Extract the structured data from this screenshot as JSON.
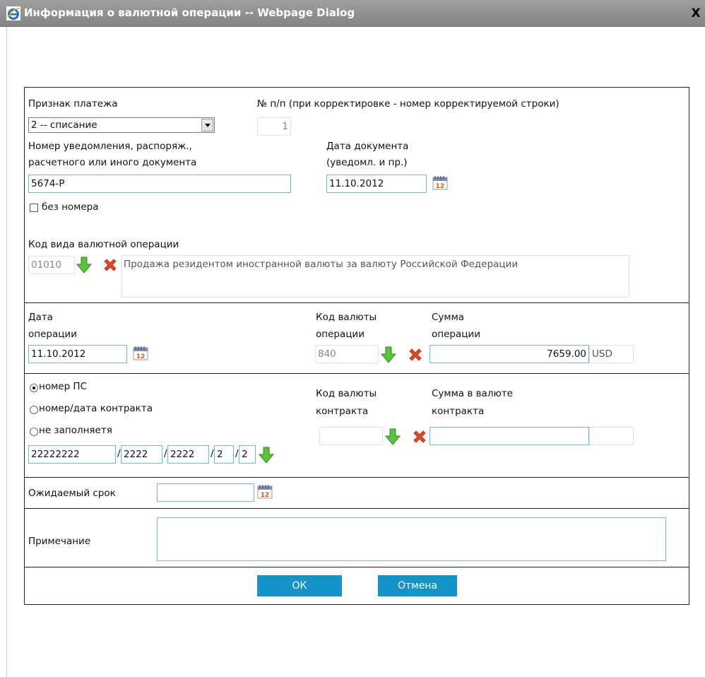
{
  "window": {
    "title": "Информация о валютной операции -- Webpage Dialog",
    "close_label": "X"
  },
  "section_payment": {
    "payment_sign_label": "Признак платежа",
    "payment_sign_value": "2 -- списание",
    "row_number_label": "№ п/п (при корректировке - номер корректируемой строки)",
    "row_number_value": "1",
    "doc_number_label_line1": "Номер уведомления, распоряж.,",
    "doc_number_label_line2": "расчетного или иного документа",
    "doc_number_value": "5674-Р",
    "doc_date_label_line1": "Дата документа",
    "doc_date_label_line2": "(уведомл. и пр.)",
    "doc_date_value": "11.10.2012",
    "no_number_label": "без номера",
    "operation_code_label": "Код вида валютной операции",
    "operation_code_value": "01010",
    "operation_code_description": "Продажа резидентом иностранной валюты за валюту Российской Федерации"
  },
  "section_operation": {
    "op_date_label_line1": "Дата",
    "op_date_label_line2": "операции",
    "op_date_value": "11.10.2012",
    "currency_code_label_line1": "Код валюты",
    "currency_code_label_line2": "операции",
    "currency_code_value": "840",
    "amount_label_line1": "Сумма",
    "amount_label_line2": "операции",
    "amount_value": "7659.00",
    "amount_currency": "USD"
  },
  "section_contract": {
    "radio_ps_label": "номер ПС",
    "radio_contract_label": "номер/дата контракта",
    "radio_none_label": "не заполняетя",
    "selected_radio": "номер ПС",
    "ps_part1": "22222222",
    "ps_part2": "2222",
    "ps_part3": "2222",
    "ps_part4": "2",
    "ps_part5": "2",
    "separator": "/",
    "contract_currency_label_line1": "Код валюты",
    "contract_currency_label_line2": "контракта",
    "contract_amount_label_line1": "Сумма в валюте",
    "contract_amount_label_line2": "контракта"
  },
  "expected_term": {
    "label": "Ожидаемый срок",
    "value": ""
  },
  "note": {
    "label": "Примечание",
    "value": ""
  },
  "buttons": {
    "ok_label": "ОК",
    "cancel_label": "Отмена"
  },
  "colors": {
    "titlebar": "#8e8e8e",
    "input_border": "#6fb6dd",
    "button_bg": "#1593c9"
  }
}
